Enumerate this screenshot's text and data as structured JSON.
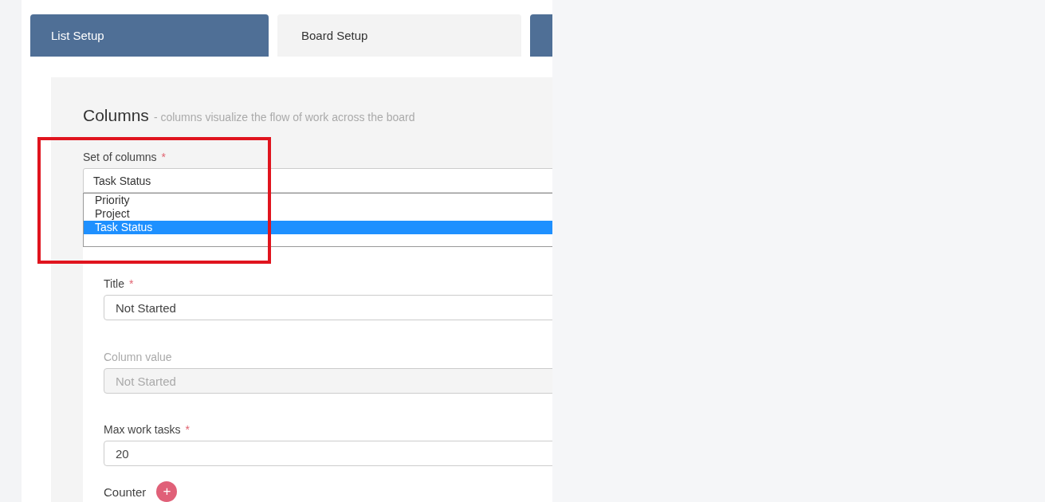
{
  "tabs": [
    {
      "kind": "tab",
      "label": "List Setup",
      "selected": true
    },
    {
      "kind": "tab",
      "label": "Board Setup",
      "selected": false
    },
    {
      "kind": "edge",
      "selected": true
    }
  ],
  "section": {
    "title": "Columns",
    "subtitle": "- columns visualize the flow of work across the board"
  },
  "set_of_columns": {
    "label": "Set of columns",
    "required": "*",
    "value": "Task Status",
    "options": [
      {
        "label": "Priority",
        "selected": false
      },
      {
        "label": "Project",
        "selected": false
      },
      {
        "label": "Task Status",
        "selected": true
      }
    ]
  },
  "fields": [
    {
      "label": "Title",
      "required": "*",
      "value": "Not Started",
      "disabled": false
    },
    {
      "label": "Column value",
      "value": "Not Started",
      "disabled": true
    },
    {
      "label": "Max work tasks",
      "required": "*",
      "value": "20",
      "disabled": false
    }
  ],
  "counter": {
    "label": "Counter",
    "button": "+"
  },
  "annotation": {
    "kind": "highlight"
  }
}
